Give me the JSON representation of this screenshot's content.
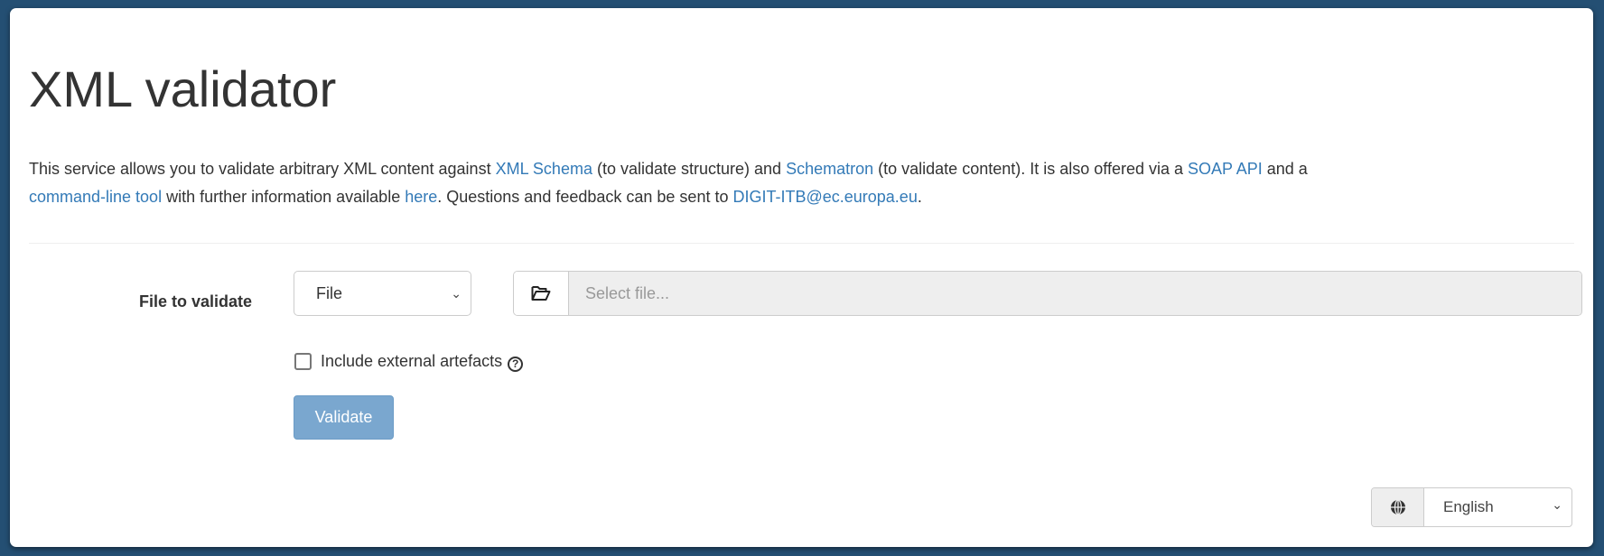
{
  "title": "XML validator",
  "description": {
    "t1": "This service allows you to validate arbitrary XML content against ",
    "link_xml_schema": "XML Schema",
    "t2": " (to validate structure) and ",
    "link_schematron": "Schematron",
    "t3": " (to validate content). It is also offered via a ",
    "link_soap_api": "SOAP API",
    "t4": " and a ",
    "link_cli": "command-line tool",
    "t5": " with further information available ",
    "link_here": "here",
    "t6": ". Questions and feedback can be sent to ",
    "link_email": "DIGIT-ITB@ec.europa.eu",
    "t7": "."
  },
  "form": {
    "file_label": "File to validate",
    "input_type_selected": "File",
    "file_placeholder": "Select file...",
    "include_external_label": "Include external artefacts",
    "include_external_checked": false,
    "validate_label": "Validate"
  },
  "language": {
    "selected": "English"
  },
  "colors": {
    "background": "#244f73",
    "link": "#337ab7",
    "button": "#7aa7cf"
  }
}
